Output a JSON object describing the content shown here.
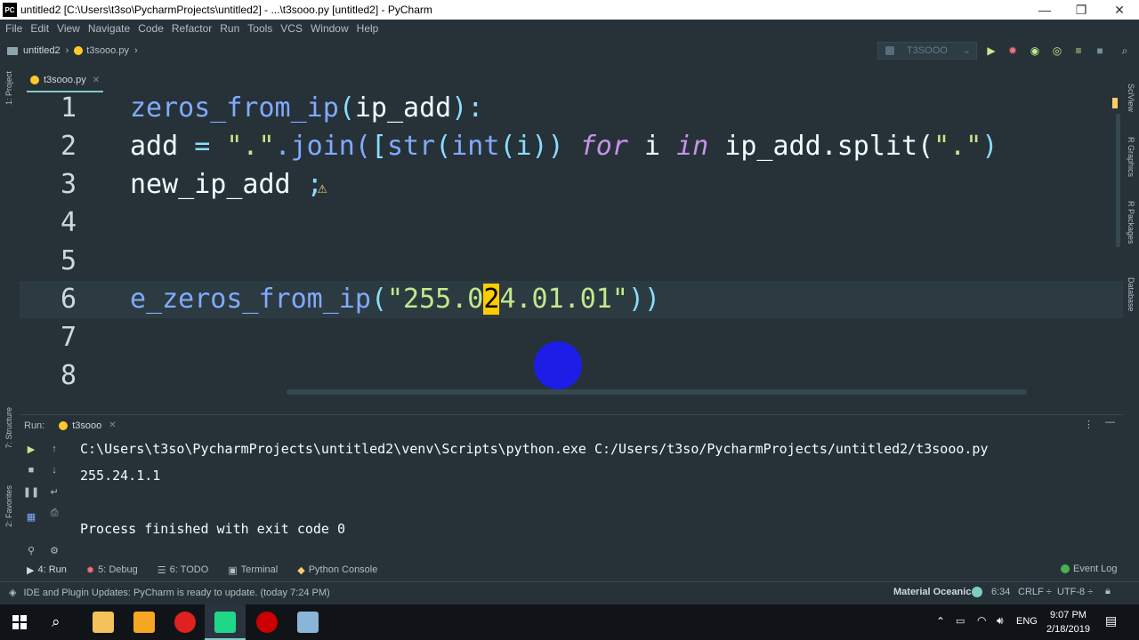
{
  "window": {
    "title": "untitled2 [C:\\Users\\t3so\\PycharmProjects\\untitled2] - ...\\t3sooo.py [untitled2] - PyCharm",
    "logo_text": "PC",
    "minimize": "—",
    "restore": "❐",
    "close": "✕"
  },
  "menu": [
    "File",
    "Edit",
    "View",
    "Navigate",
    "Code",
    "Refactor",
    "Run",
    "Tools",
    "VCS",
    "Window",
    "Help"
  ],
  "nav": {
    "project": "untitled2",
    "file": "t3sooo.py",
    "run_config": "T3SOOO"
  },
  "left_strip": {
    "project": "1: Project",
    "structure": "7: Structure",
    "favorites": "2: Favorites"
  },
  "right_strip": {
    "sciview": "SciView",
    "rgraphics": "R Graphics",
    "rpackages": "R Packages",
    "database": "Database"
  },
  "editor_tab": {
    "label": "t3sooo.py",
    "close": "✕"
  },
  "editor": {
    "line_numbers": [
      "1",
      "2",
      "3",
      "4",
      "5",
      "6",
      "7",
      "8"
    ],
    "line1": {
      "name": "zeros_from_ip",
      "open": "(",
      "param": "ip_add",
      "close": "):"
    },
    "line2": {
      "var": "add ",
      "eq": "= ",
      "str_dot": "\".\"",
      "join": ".join(",
      "lb": "[",
      "str_fn": "str",
      "p1": "(",
      "int_fn": "int",
      "p2": "(i)) ",
      "for": "for",
      "i": " i ",
      "in": "in",
      "rest": " ip_add.split(",
      "str_dot2": "\".\"",
      "tail": ")"
    },
    "line3": {
      "text": "new_ip_add ",
      "semi": ";"
    },
    "line6": {
      "call": "e_zeros_from_ip",
      "open": "(",
      "s1": "\"255.0",
      "hl": "2",
      "s2": "4.01.01\"",
      "close": "))"
    }
  },
  "run": {
    "label": "Run:",
    "tab": "t3sooo",
    "close": "✕",
    "command": "C:\\Users\\t3so\\PycharmProjects\\untitled2\\venv\\Scripts\\python.exe C:/Users/t3so/PycharmProjects/untitled2/t3sooo.py",
    "output": "255.24.1.1",
    "finished": "Process finished with exit code 0"
  },
  "tool_tabs": [
    "4: Run",
    "5: Debug",
    "6: TODO",
    "Terminal",
    "Python Console"
  ],
  "event_log": "Event Log",
  "status": {
    "message": "IDE and Plugin Updates: PyCharm is ready to update. (today 7:24 PM)",
    "theme": "Material Oceanic",
    "position": "6:34",
    "line_sep": "CRLF ÷",
    "encoding": "UTF-8 ÷"
  },
  "taskbar": {
    "lang": "ENG",
    "time": "9:07 PM",
    "date": "2/18/2019"
  },
  "colors": {
    "accent": "#80cbc4",
    "highlight": "#ffcc00",
    "cursor_dot": "#1d1de8"
  }
}
